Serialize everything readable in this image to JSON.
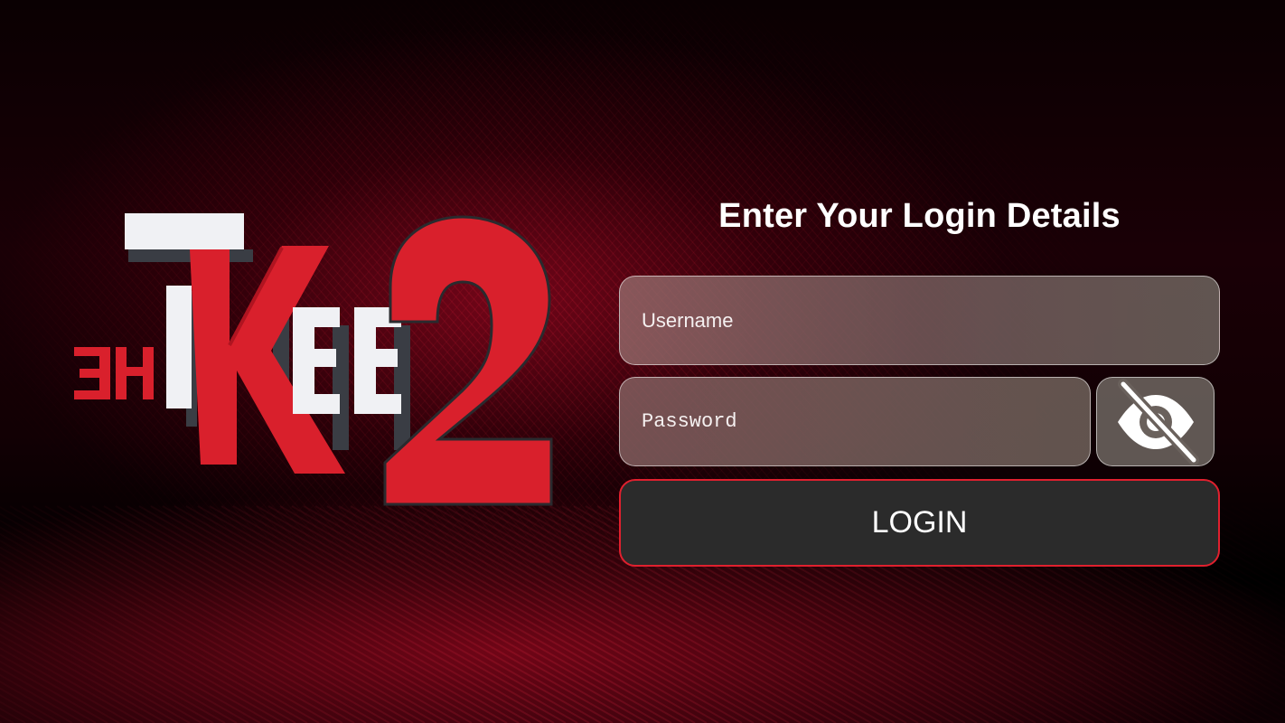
{
  "logo": {
    "text": "IKEE 2",
    "prefix_text": "3H"
  },
  "form": {
    "title": "Enter Your Login Details",
    "username": {
      "placeholder": "Username",
      "value": ""
    },
    "password": {
      "placeholder": "Password",
      "value": ""
    },
    "toggle_icon": "eye-slash-icon",
    "login_label": "LOGIN"
  },
  "colors": {
    "accent": "#e0202e",
    "button_bg": "#2b2b2b",
    "logo_red": "#d9202c",
    "logo_white": "#f0f1f4"
  }
}
